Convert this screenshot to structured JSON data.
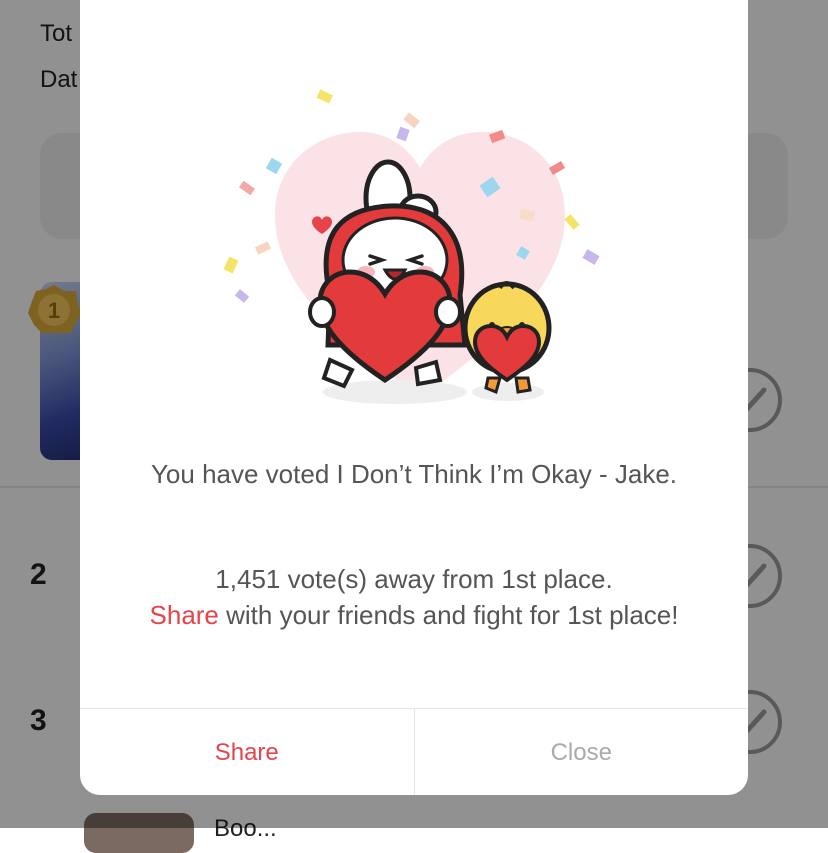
{
  "background": {
    "label_total": "Tot",
    "label_date": "Dat",
    "medal_rank": "1",
    "ranks": [
      "2",
      "3"
    ],
    "bottom_text": "Boo..."
  },
  "dialog": {
    "voted_message": "You have voted I Don’t Think I’m Okay - Jake.",
    "distance_message": "1,451 vote(s) away from 1st place.",
    "share_word": "Share",
    "share_rest": " with your friends and fight for 1st place!",
    "share_button": "Share",
    "close_button": "Close"
  },
  "colors": {
    "accent": "#e8424a",
    "muted": "#aaaaaa"
  }
}
